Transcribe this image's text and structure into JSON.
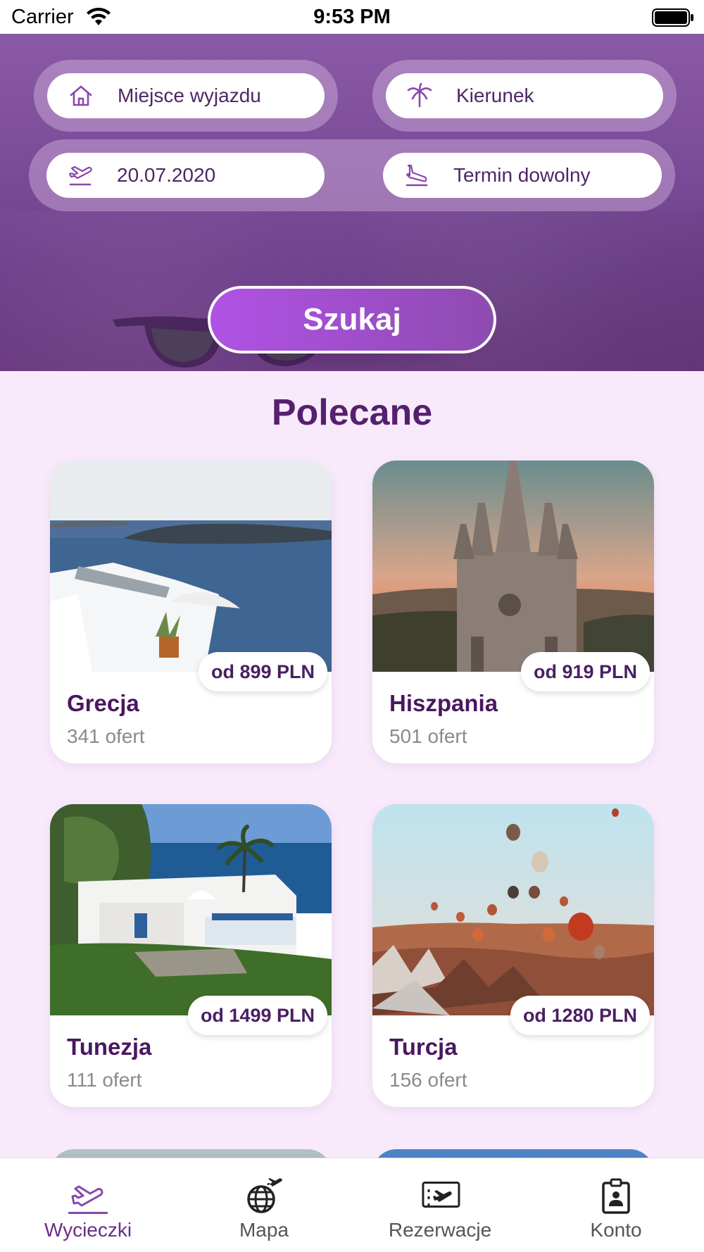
{
  "status_bar": {
    "carrier": "Carrier",
    "time": "9:53 PM"
  },
  "search": {
    "departure_placeholder": "Miejsce wyjazdu",
    "destination_placeholder": "Kierunek",
    "date_value": "20.07.2020",
    "term_value": "Termin dowolny",
    "button_label": "Szukaj",
    "icons": {
      "departure": "home-icon",
      "destination": "palm-tree-icon",
      "date": "plane-takeoff-icon",
      "term": "plane-landing-icon"
    }
  },
  "section": {
    "title": "Polecane"
  },
  "offers": [
    {
      "name": "Grecja",
      "count": "341 ofert",
      "price": "od 899 PLN"
    },
    {
      "name": "Hiszpania",
      "count": "501 ofert",
      "price": "od 919 PLN"
    },
    {
      "name": "Tunezja",
      "count": "111 ofert",
      "price": "od 1499 PLN"
    },
    {
      "name": "Turcja",
      "count": "156 ofert",
      "price": "od 1280 PLN"
    }
  ],
  "tab_bar": {
    "items": [
      {
        "label": "Wycieczki",
        "icon": "plane-icon",
        "active": true
      },
      {
        "label": "Mapa",
        "icon": "globe-plane-icon",
        "active": false
      },
      {
        "label": "Rezerwacje",
        "icon": "ticket-plane-icon",
        "active": false
      },
      {
        "label": "Konto",
        "icon": "id-badge-icon",
        "active": false
      }
    ]
  },
  "colors": {
    "accent": "#8a47ad",
    "title": "#55206e",
    "background": "#f8eafb",
    "button_gradient_start": "#b052e6",
    "button_gradient_end": "#8e4bb0"
  }
}
